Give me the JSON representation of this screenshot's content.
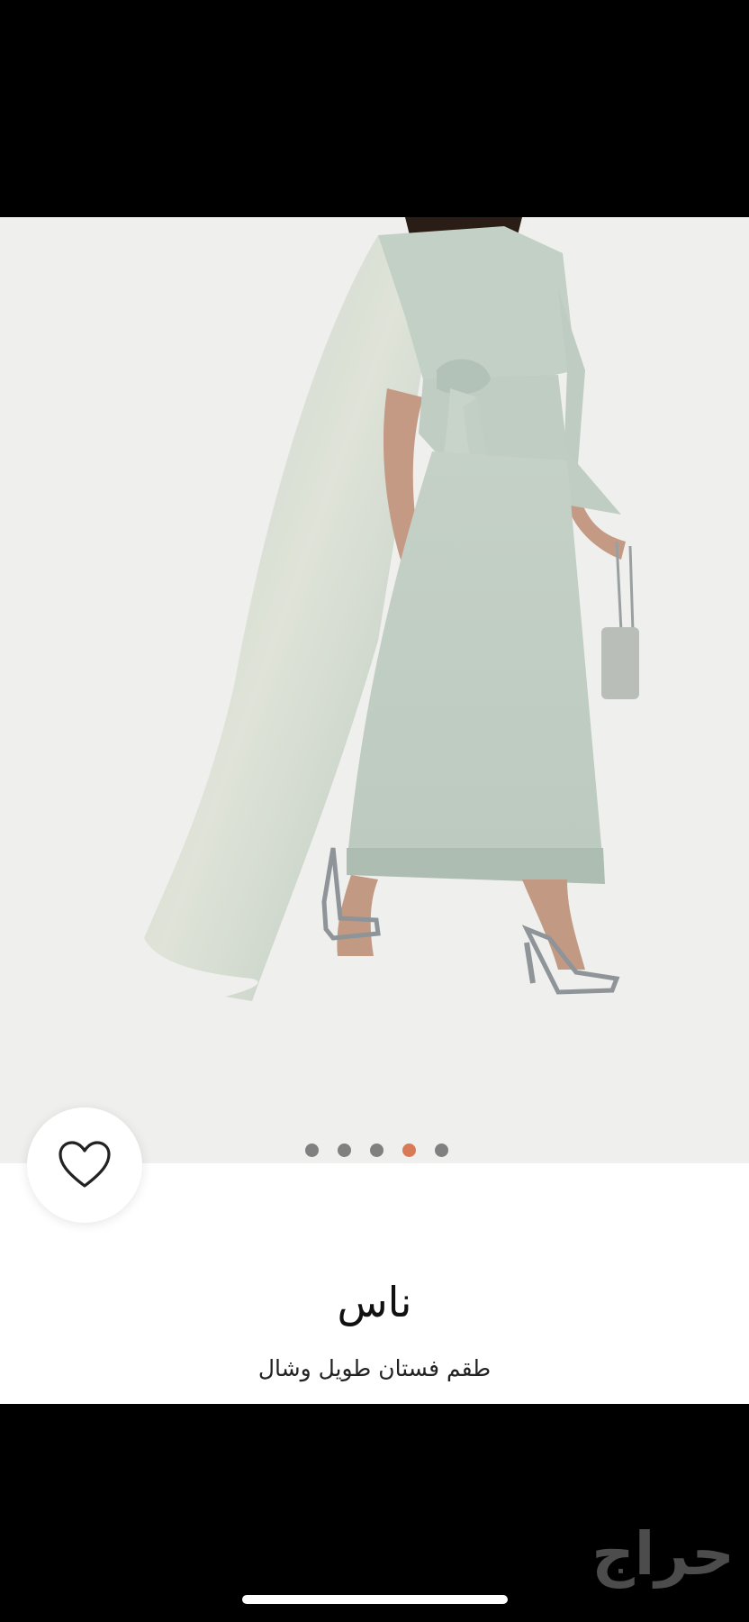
{
  "product": {
    "brand": "ناس",
    "name": "طقم فستان طويل وشال"
  },
  "gallery": {
    "image_count": 5,
    "active_index": 3,
    "dot_color": "#808080",
    "active_dot_color": "#d97a57"
  },
  "favorite": {
    "icon": "heart-outline-icon"
  },
  "watermark": {
    "text": "حراج"
  },
  "colors": {
    "background": "#000000",
    "panel": "#ffffff",
    "photo_bg": "#efefed"
  }
}
